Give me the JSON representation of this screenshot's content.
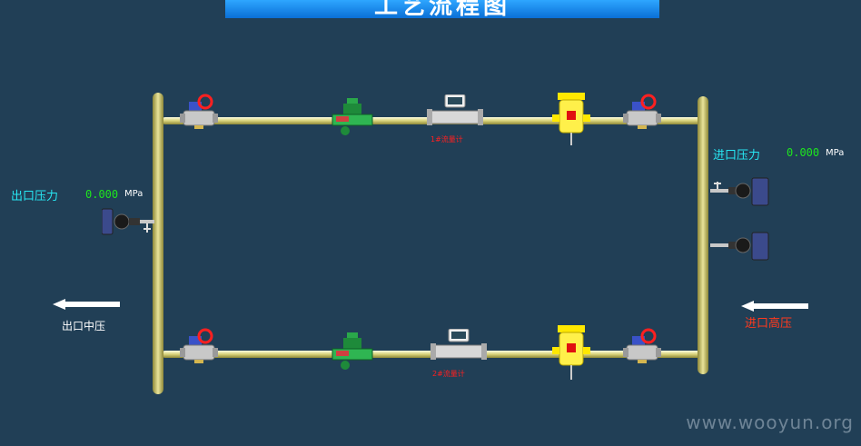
{
  "title": "工艺流程图",
  "outlet_pressure": {
    "label": "出口压力",
    "value": "0.000",
    "unit": "MPa"
  },
  "inlet_pressure": {
    "label": "进口压力",
    "value": "0.000",
    "unit": "MPa"
  },
  "outlet_arrow_label": "出口中压",
  "inlet_arrow_label": "进口高压",
  "flowmeter_1_label": "1#流量计",
  "flowmeter_2_label": "2#流量计",
  "watermark": "www.wooyun.org"
}
